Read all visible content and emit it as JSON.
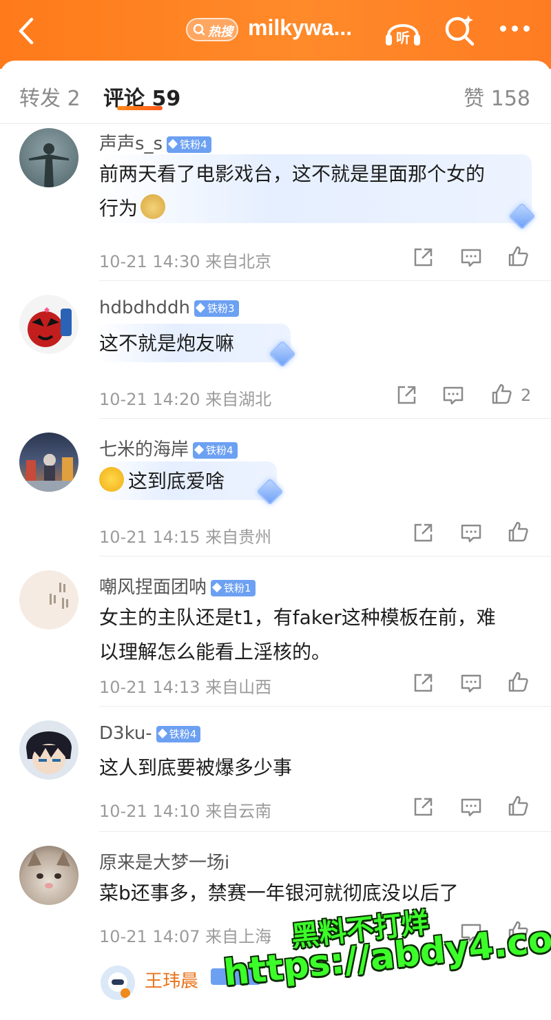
{
  "header": {
    "hot_search_label": "热搜",
    "title": "milkywa...",
    "listen_label": "听"
  },
  "tabs": {
    "repost": "转发 2",
    "comments": "评论 59",
    "likes": "赞 158"
  },
  "comments": [
    {
      "user": "声声s_s",
      "badge": "铁粉4",
      "text_lines": [
        "前两天看了电影戏台，这不就是里面那个女的",
        "行为"
      ],
      "emoji": "doge-emoji",
      "meta": "10-21 14:30 来自北京",
      "likes": ""
    },
    {
      "user": "hdbdhddh",
      "badge": "铁粉3",
      "text_lines": [
        "这不就是炮友嘛"
      ],
      "meta": "10-21 14:20 来自湖北",
      "likes": "2"
    },
    {
      "user": "七米的海岸",
      "badge": "铁粉4",
      "text_lines": [
        "这到底爱啥"
      ],
      "emoji": "sweat-emoji",
      "meta": "10-21 14:15 来自贵州",
      "likes": ""
    },
    {
      "user": "嘲风捏面团呐",
      "badge": "铁粉1",
      "text_lines": [
        "女主的主队还是t1，有faker这种模板在前，难",
        "以理解怎么能看上淫核的。"
      ],
      "meta": "10-21 14:13 来自山西",
      "likes": ""
    },
    {
      "user": "D3ku-",
      "badge": "铁粉4",
      "text_lines": [
        "这人到底要被爆多少事"
      ],
      "meta": "10-21 14:10 来自云南",
      "likes": ""
    },
    {
      "user": "原来是大梦一场i",
      "badge": "",
      "text_lines": [
        "菜b还事多，禁赛一年银河就彻底没以后了"
      ],
      "meta": "10-21 14:07 来自上海",
      "likes": ""
    }
  ],
  "reply_preview": {
    "user": "王玮晨"
  },
  "watermark": {
    "line1": "黑料不打烊",
    "line2": "https://abdy4.com"
  }
}
